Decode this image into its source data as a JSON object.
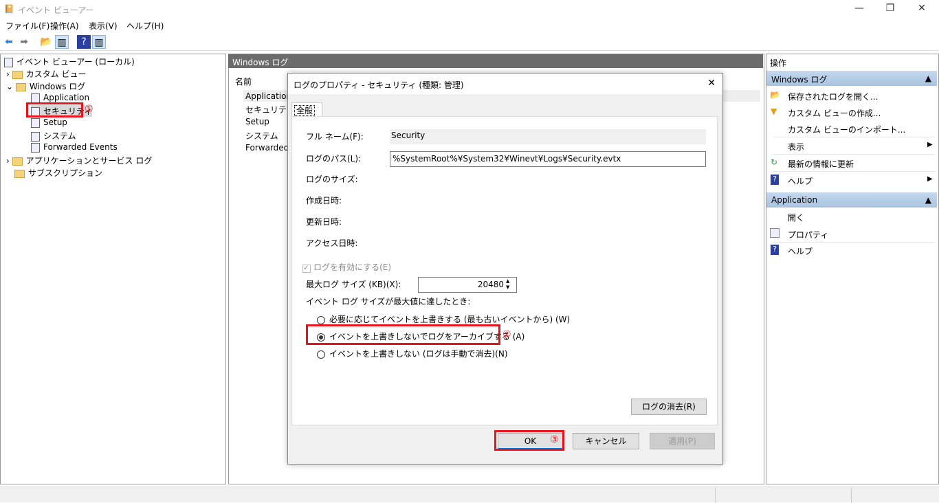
{
  "window": {
    "title": "イベント ビューアー",
    "minimize": "—",
    "maximize": "❐",
    "close": "✕"
  },
  "menu": [
    "ファイル(F)",
    "操作(A)",
    "表示(V)",
    "ヘルプ(H)"
  ],
  "tree": {
    "root": "イベント ビューアー (ローカル)",
    "custom_view": "カスタム ビュー",
    "windows_logs": "Windows ログ",
    "items": [
      "Application",
      "セキュリティ",
      "Setup",
      "システム",
      "Forwarded Events"
    ],
    "apps_services": "アプリケーションとサービス ログ",
    "subscriptions": "サブスクリプション"
  },
  "middle": {
    "header": "Windows ログ",
    "column": "名前",
    "rows": [
      "Application",
      "セキュリティ",
      "Setup",
      "システム",
      "Forwarded E"
    ]
  },
  "dialog": {
    "title": "ログのプロパティ - セキュリティ (種類: 管理)",
    "tab": "全般",
    "full_name_label": "フル ネーム(F):",
    "full_name": "Security",
    "path_label": "ログのパス(L):",
    "path": "%SystemRoot%¥System32¥Winevt¥Logs¥Security.evtx",
    "size_label": "ログのサイズ:",
    "created_label": "作成日時:",
    "modified_label": "更新日時:",
    "accessed_label": "アクセス日時:",
    "enable_label": "ログを有効にする(E)",
    "enable_checked": true,
    "max_size_label": "最大ログ サイズ (KB)(X):",
    "max_size": "20480",
    "when_full_label": "イベント ログ サイズが最大値に達したとき:",
    "options": [
      "必要に応じてイベントを上書きする (最も古いイベントから) (W)",
      "イベントを上書きしないでログをアーカイブする (A)",
      "イベントを上書きしない (ログは手動で消去)(N)"
    ],
    "selected_option": 1,
    "clear_button": "ログの消去(R)",
    "ok": "OK",
    "cancel": "キャンセル",
    "apply": "適用(P)"
  },
  "annotations": [
    "①",
    "②",
    "③"
  ],
  "actions": {
    "header": "操作",
    "group1": "Windows ログ",
    "items1": [
      "保存されたログを開く...",
      "カスタム ビューの作成...",
      "カスタム ビューのインポート...",
      "表示",
      "最新の情報に更新",
      "ヘルプ"
    ],
    "group2": "Application",
    "items2": [
      "開く",
      "プロパティ",
      "ヘルプ"
    ]
  },
  "colors": {
    "highlight": "#e8141b",
    "group_header": "#b8cfe8",
    "pane_header": "#6b6b6b"
  }
}
